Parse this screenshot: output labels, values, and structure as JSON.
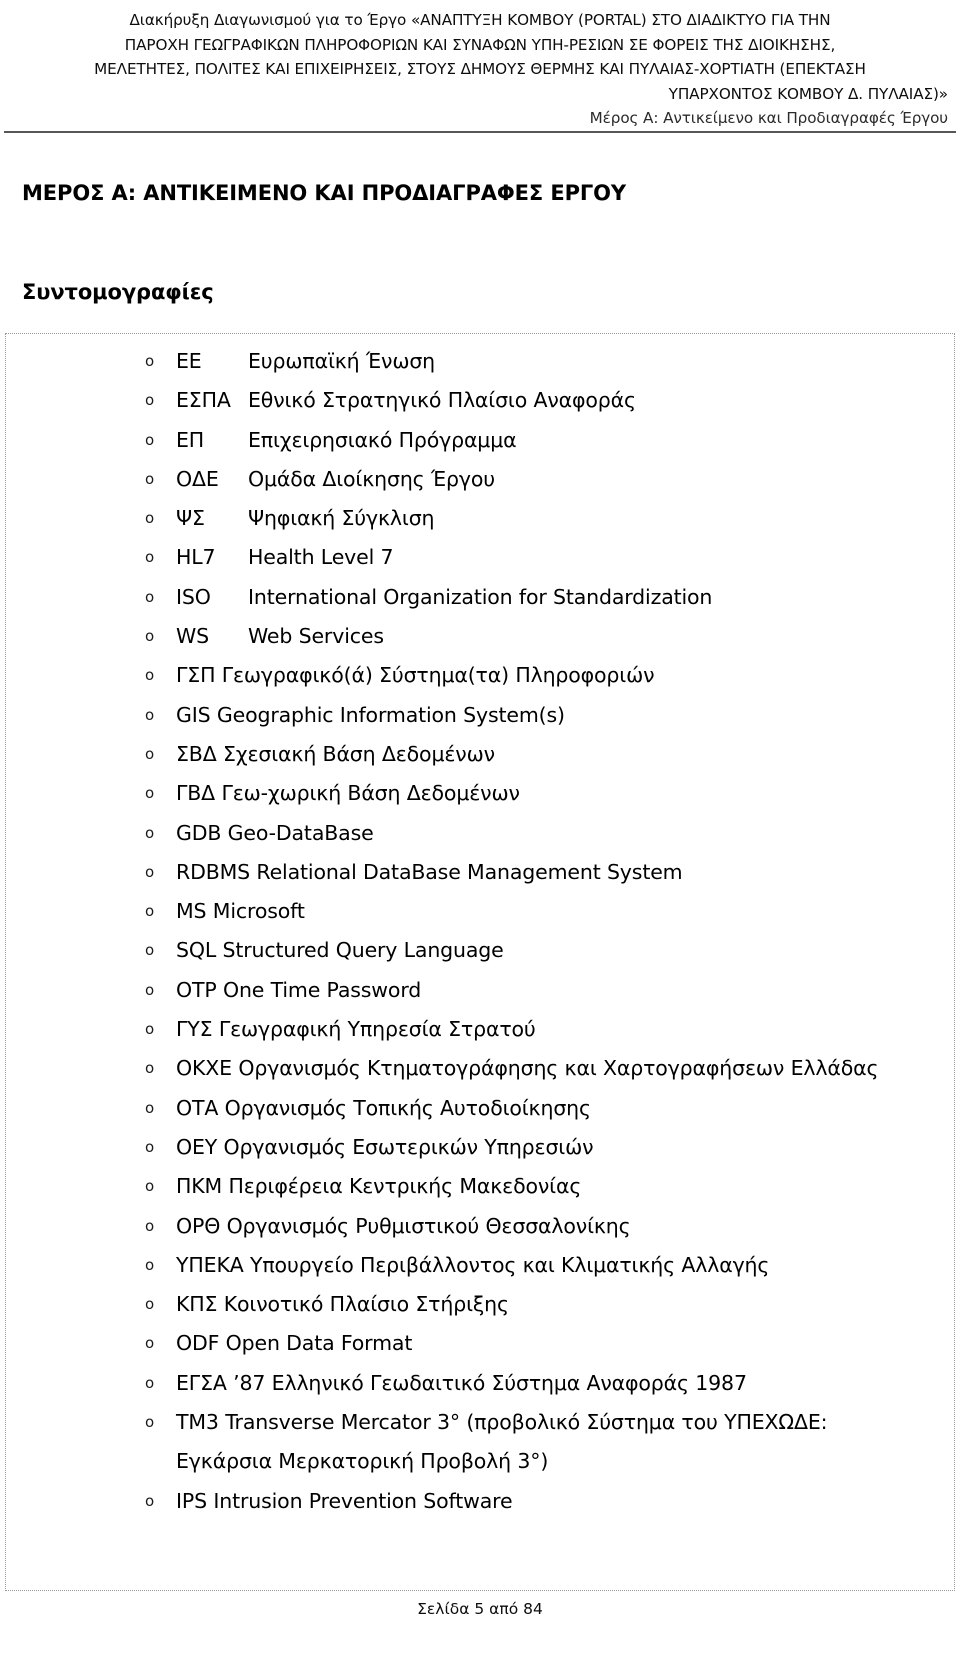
{
  "header": {
    "lines": [
      "Διακήρυξη Διαγωνισμού για το Έργο «ΑΝΑΠΤΥΞΗ ΚΟΜΒΟΥ (PORTAL) ΣΤΟ ΔΙΑΔΙΚΤΥΟ ΓΙΑ ΤΗΝ",
      "ΠΑΡΟΧΗ ΓΕΩΓΡΑΦΙΚΩΝ ΠΛΗΡΟΦΟΡΙΩΝ ΚΑΙ ΣΥΝΑΦΩΝ ΥΠΗ-ΡΕΣΙΩΝ ΣΕ ΦΟΡΕΙΣ ΤΗΣ ΔΙΟΙΚΗΣΗΣ,",
      "ΜΕΛΕΤΗΤΕΣ, ΠΟΛΙΤΕΣ ΚΑΙ ΕΠΙΧΕΙΡΗΣΕΙΣ, ΣΤΟΥΣ ΔΗΜΟΥΣ ΘΕΡΜΗΣ ΚΑΙ ΠΥΛΑΙΑΣ-ΧΟΡΤΙΑΤΗ (ΕΠΕΚΤΑΣΗ",
      "ΥΠΑΡΧΟΝΤΟΣ ΚΟΜΒΟΥ Δ. ΠΥΛΑΙΑΣ)»"
    ],
    "subtitle": "Μέρος Α: Αντικείμενο και Προδιαγραφές Έργου"
  },
  "main": {
    "part_title": "ΜΕΡΟΣ Α: ΑΝΤΙΚΕΙΜΕΝΟ ΚΑΙ ΠΡΟΔΙΑΓΡΑΦΕΣ ΕΡΓΟΥ",
    "section_title": "Συντομογραφίες",
    "bullet_glyph": "o",
    "items": [
      {
        "abbr": "ΕΕ",
        "desc": "Ευρωπαϊκή Ένωση",
        "tabbed": true
      },
      {
        "abbr": "ΕΣΠΑ",
        "desc": "Εθνικό Στρατηγικό Πλαίσιο Αναφοράς",
        "tabbed": true
      },
      {
        "abbr": "ΕΠ",
        "desc": "Επιχειρησιακό Πρόγραμμα",
        "tabbed": true
      },
      {
        "abbr": "ΟΔΕ",
        "desc": "Ομάδα Διοίκησης Έργου",
        "tabbed": true
      },
      {
        "abbr": "ΨΣ",
        "desc": "Ψηφιακή Σύγκλιση",
        "tabbed": true
      },
      {
        "abbr": "HL7",
        "desc": "Health Level 7",
        "tabbed": true
      },
      {
        "abbr": "ISO",
        "desc": "International Organization for Standardization",
        "tabbed": true
      },
      {
        "abbr": "WS",
        "desc": "Web Services",
        "tabbed": true
      },
      {
        "abbr": "ΓΣΠ",
        "desc": "Γεωγραφικό(ά) Σύστημα(τα) Πληροφοριών",
        "tabbed": false
      },
      {
        "abbr": "GIS",
        "desc": "Geographic Information System(s)",
        "tabbed": false
      },
      {
        "abbr": "ΣΒΔ",
        "desc": "Σχεσιακή Βάση Δεδομένων",
        "tabbed": false
      },
      {
        "abbr": "ΓΒΔ",
        "desc": "Γεω-χωρική Βάση Δεδομένων",
        "tabbed": false
      },
      {
        "abbr": "GDB",
        "desc": "Geo-DataBase",
        "tabbed": false
      },
      {
        "abbr": "RDBMS",
        "desc": "Relational DataBase Management System",
        "tabbed": false
      },
      {
        "abbr": "MS",
        "desc": "Microsoft",
        "tabbed": false
      },
      {
        "abbr": "SQL",
        "desc": "Structured Query Language",
        "tabbed": false
      },
      {
        "abbr": "OTP",
        "desc": "One Time Password",
        "tabbed": false
      },
      {
        "abbr": "ΓΥΣ",
        "desc": "Γεωγραφική Υπηρεσία Στρατού",
        "tabbed": false
      },
      {
        "abbr": "ΟΚΧΕ",
        "desc": "Οργανισμός Κτηματογράφησης και Χαρτογραφήσεων Ελλάδας",
        "tabbed": false
      },
      {
        "abbr": "ΟΤΑ",
        "desc": "Οργανισμός Τοπικής Αυτοδιοίκησης",
        "tabbed": false
      },
      {
        "abbr": "ΟΕΥ",
        "desc": "Οργανισμός Εσωτερικών Υπηρεσιών",
        "tabbed": false
      },
      {
        "abbr": "ΠΚΜ",
        "desc": "Περιφέρεια Κεντρικής Μακεδονίας",
        "tabbed": false
      },
      {
        "abbr": "ΟΡΘ",
        "desc": "Οργανισμός Ρυθμιστικού Θεσσαλονίκης",
        "tabbed": false
      },
      {
        "abbr": "ΥΠΕΚΑ",
        "desc": "Υπουργείο Περιβάλλοντος και Κλιματικής Αλλαγής",
        "tabbed": false
      },
      {
        "abbr": "ΚΠΣ",
        "desc": "Κοινοτικό Πλαίσιο Στήριξης",
        "tabbed": false
      },
      {
        "abbr": "ODF",
        "desc": "Open Data Format",
        "tabbed": false
      },
      {
        "abbr": "ΕΓΣΑ ’87",
        "desc": "Ελληνικό Γεωδαιτικό Σύστημα Αναφοράς 1987",
        "tabbed": false
      },
      {
        "abbr": "TM3",
        "desc": "Transverse Mercator 3° (προβολικό Σύστημα του ΥΠΕΧΩΔΕ: Εγκάρσια Μερκατορική Προβολή 3°)",
        "tabbed": false,
        "wrap": true
      },
      {
        "abbr": "IPS",
        "desc": "Intrusion Prevention Software",
        "tabbed": false
      }
    ]
  },
  "footer": {
    "page_label": "Σελίδα 5 από 84"
  }
}
